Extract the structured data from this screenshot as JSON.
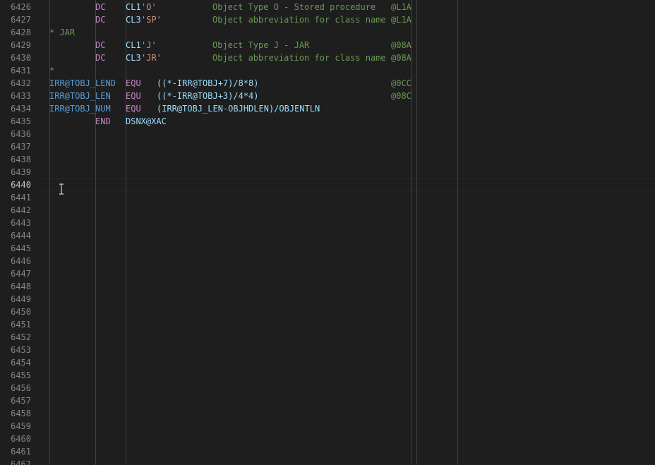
{
  "editor": {
    "line_numbers": [
      "6426",
      "6427",
      "6428",
      "6429",
      "6430",
      "6431",
      "6432",
      "6433",
      "6434",
      "6435",
      "6436",
      "6437",
      "6438",
      "6439",
      "6440",
      "6441",
      "6442",
      "6443",
      "6444",
      "6445",
      "6446",
      "6447",
      "6448",
      "6449",
      "6450",
      "6451",
      "6452",
      "6453",
      "6454",
      "6455",
      "6456",
      "6457",
      "6458",
      "6459",
      "6460",
      "6461",
      "6462"
    ],
    "current_line": "6440",
    "lines": [
      {
        "op": "DC",
        "cl": "CL1",
        "str": "'O'",
        "cmt": "Object Type O - Stored procedure",
        "seq": "@L1A"
      },
      {
        "op": "DC",
        "cl": "CL3",
        "str": "'SP'",
        "cmt": "Object abbreviation for class name",
        "seq": "@L1A"
      },
      {
        "comment_line": "* JAR"
      },
      {
        "op": "DC",
        "cl": "CL1",
        "str": "'J'",
        "cmt": "Object Type J - JAR",
        "seq": "@08A"
      },
      {
        "op": "DC",
        "cl": "CL3",
        "str": "'JR'",
        "cmt": "Object abbreviation for class name",
        "seq": "@08A"
      },
      {
        "comment_line": "*"
      },
      {
        "label": "IRR@TOBJ_LEND",
        "op": "EQU",
        "expr": "((*-IRR@TOBJ+7)/8*8)",
        "seq": "@0CC"
      },
      {
        "label": "IRR@TOBJ_LEN",
        "op": "EQU",
        "expr": "((*-IRR@TOBJ+3)/4*4)",
        "seq": "@08C"
      },
      {
        "label": "IRR@TOBJ_NUM",
        "op": "EQU",
        "expr": "(IRR@TOBJ_LEN-OBJHDLEN)/OBJENTLN"
      },
      {
        "op": "END",
        "expr": "DSNX@XAC"
      }
    ]
  },
  "icons": {
    "cursor": "text-cursor-icon"
  }
}
